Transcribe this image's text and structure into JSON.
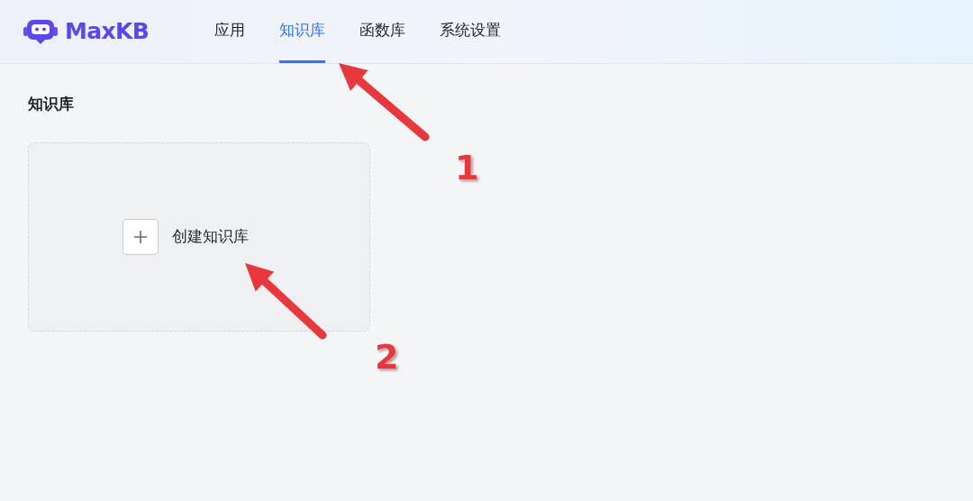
{
  "header": {
    "logo_text": "MaxKB",
    "nav": [
      {
        "label": "应用",
        "selected": false
      },
      {
        "label": "知识库",
        "selected": true
      },
      {
        "label": "函数库",
        "selected": false
      },
      {
        "label": "系统设置",
        "selected": false
      }
    ]
  },
  "page": {
    "title": "知识库",
    "create_card": {
      "label": "创建知识库"
    }
  },
  "annotations": [
    {
      "label": "1"
    },
    {
      "label": "2"
    }
  ]
}
